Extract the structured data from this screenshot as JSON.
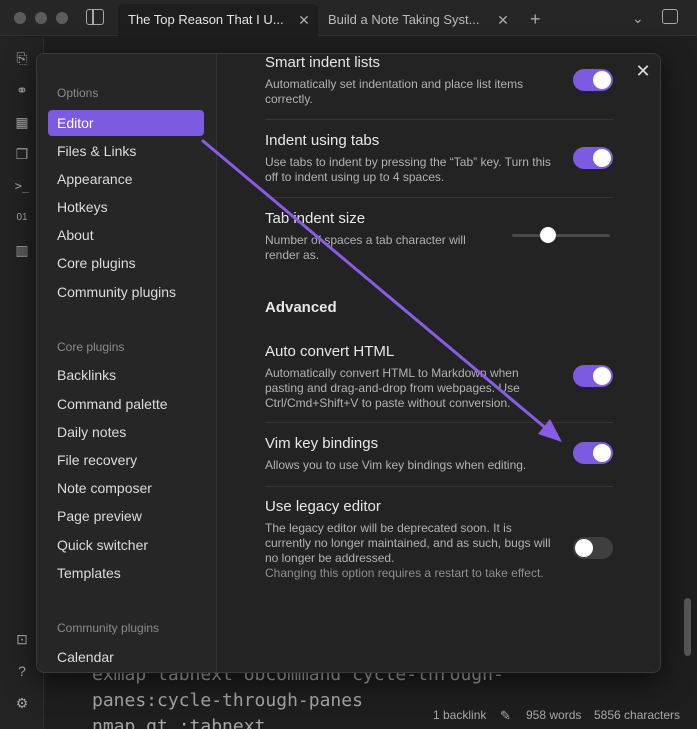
{
  "tabs": [
    {
      "label": "The Top Reason That I U..."
    },
    {
      "label": "Build a Note Taking Syst..."
    }
  ],
  "editor": {
    "lines": [
      "exmap tabnext obcommand cycle-through-",
      "panes:cycle-through-panes",
      "nmap gt :tabnext"
    ]
  },
  "status": {
    "backlinks": "1 backlink",
    "words": "958 words",
    "characters": "5856 characters"
  },
  "settings_nav": {
    "options_heading": "Options",
    "options": [
      "Editor",
      "Files & Links",
      "Appearance",
      "Hotkeys",
      "About",
      "Core plugins",
      "Community plugins"
    ],
    "core_heading": "Core plugins",
    "core": [
      "Backlinks",
      "Command palette",
      "Daily notes",
      "File recovery",
      "Note composer",
      "Page preview",
      "Quick switcher",
      "Templates"
    ],
    "community_heading": "Community plugins",
    "community": [
      "Calendar"
    ]
  },
  "settings": {
    "smart_indent": {
      "name": "Smart indent lists",
      "desc": "Automatically set indentation and place list items correctly.",
      "enabled": true
    },
    "indent_tabs": {
      "name": "Indent using tabs",
      "desc": "Use tabs to indent by pressing the “Tab” key. Turn this off to indent using up to 4 spaces.",
      "enabled": true
    },
    "tab_size": {
      "name": "Tab indent size",
      "desc": "Number of spaces a tab character will render as."
    },
    "advanced_heading": "Advanced",
    "auto_html": {
      "name": "Auto convert HTML",
      "desc": "Automatically convert HTML to Markdown when pasting and drag-and-drop from webpages. Use Ctrl/Cmd+Shift+V to paste without conversion.",
      "enabled": true
    },
    "vim": {
      "name": "Vim key bindings",
      "desc": "Allows you to use Vim key bindings when editing.",
      "enabled": true
    },
    "legacy": {
      "name": "Use legacy editor",
      "desc": "The legacy editor will be deprecated soon. It is currently no longer maintained, and as such, bugs will no longer be addressed.",
      "note": "Changing this option requires a restart to take effect.",
      "enabled": false
    }
  },
  "colors": {
    "accent": "#7c5be0",
    "annotation_arrow": "#8a5ce6"
  },
  "icons": {
    "close": "close-icon",
    "ribbon": [
      "open-file-icon",
      "graph-view-icon",
      "calendar-icon",
      "copy-icon",
      "terminal-icon",
      "binary-icon",
      "kanban-icon",
      "vault-icon",
      "help-icon",
      "settings-icon"
    ]
  }
}
